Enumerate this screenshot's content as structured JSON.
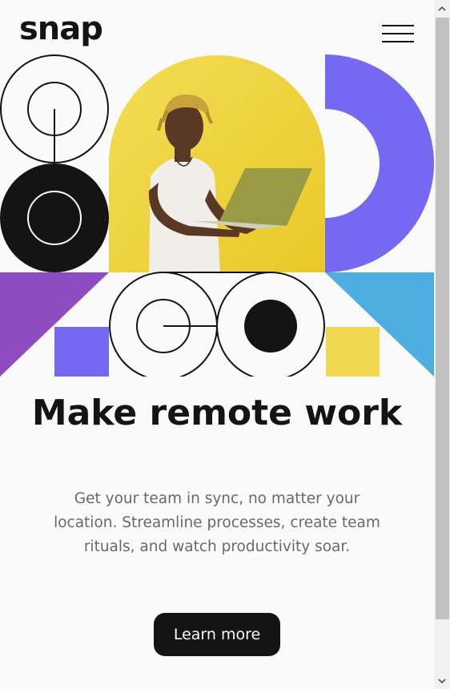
{
  "header": {
    "logo_text": "snap",
    "menu_icon": "hamburger-menu-icon"
  },
  "hero": {
    "image_alt": "Person using a laptop",
    "colors": {
      "yellow": "#f0d94e",
      "purple": "#7469f0",
      "violet": "#8e4cc1",
      "blue": "#4eaee0",
      "black": "#141414"
    }
  },
  "main": {
    "headline": "Make remote work",
    "subtext": "Get your team in sync, no matter your location. Streamline processes, create team rituals, and watch productivity soar.",
    "cta_label": "Learn more"
  },
  "scrollbar": {
    "up_icon": "chevron-up-icon",
    "down_icon": "chevron-down-icon"
  }
}
